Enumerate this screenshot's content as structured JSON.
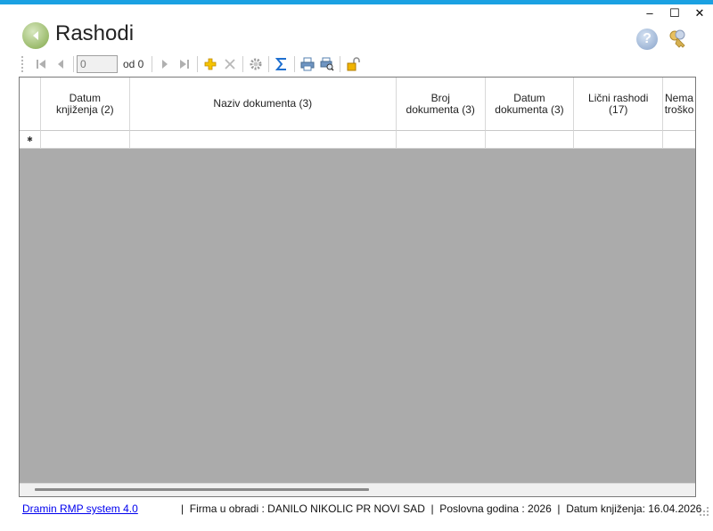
{
  "window": {
    "minimize_glyph": "–",
    "maximize_glyph": "☐",
    "close_glyph": "✕",
    "accent_color": "#1ba1e2"
  },
  "header": {
    "title": "Rashodi",
    "back_icon": "back-arrow-icon",
    "help_icon": "help-icon",
    "keys_icon": "keys-icon",
    "help_glyph": "?"
  },
  "toolbar": {
    "record_value": "0",
    "record_of_label": "od 0",
    "buttons": [
      "first-record",
      "previous-record",
      "next-record",
      "last-record",
      "add",
      "delete",
      "settings",
      "sum",
      "print",
      "print-preview",
      "unlock"
    ]
  },
  "grid": {
    "columns": [
      {
        "label": "Datum\nknjiženja (2)"
      },
      {
        "label": "Naziv dokumenta (3)"
      },
      {
        "label": "Broj\ndokumenta (3)"
      },
      {
        "label": "Datum\ndokumenta (3)"
      },
      {
        "label": "Lični rashodi\n(17)"
      },
      {
        "label": "Nema\ntroško"
      }
    ],
    "new_row_marker": "✱",
    "background_color": "#ababab"
  },
  "statusbar": {
    "app_link": "Dramin RMP system 4.0",
    "info": "|  Firma u obradi : DANILO NIKOLIC PR NOVI SAD  |  Poslovna godina : 2026  |  Datum knjiženja: 16.04.2026"
  }
}
